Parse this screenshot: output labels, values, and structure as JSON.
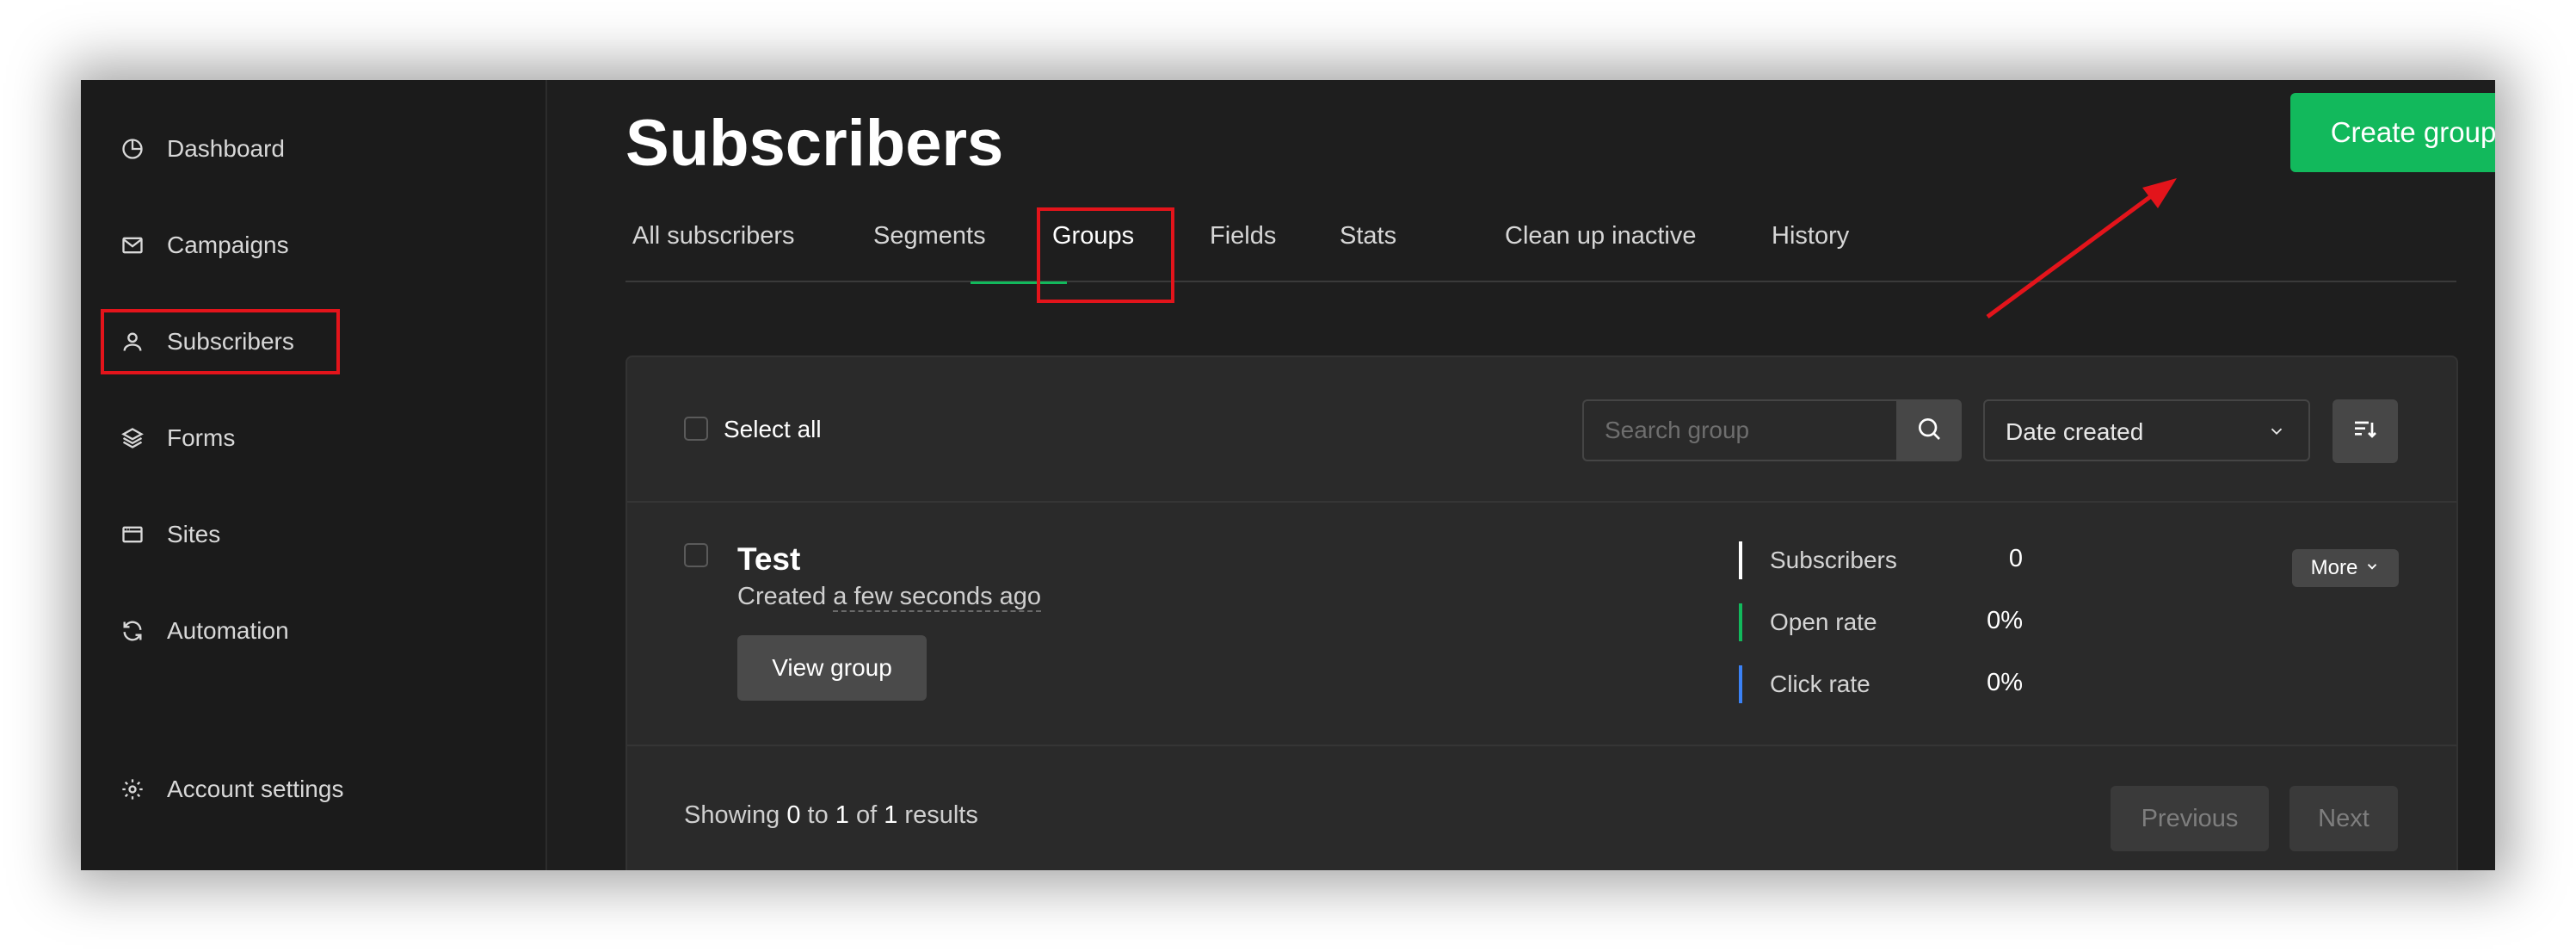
{
  "sidebar": {
    "items": [
      {
        "label": "Dashboard",
        "icon": "dashboard-pie-icon"
      },
      {
        "label": "Campaigns",
        "icon": "envelope-icon"
      },
      {
        "label": "Subscribers",
        "icon": "user-icon",
        "active": true
      },
      {
        "label": "Forms",
        "icon": "layers-icon"
      },
      {
        "label": "Sites",
        "icon": "browser-window-icon"
      },
      {
        "label": "Automation",
        "icon": "refresh-icon"
      }
    ],
    "account_settings": {
      "label": "Account settings",
      "icon": "gear-icon"
    }
  },
  "header": {
    "title": "Subscribers",
    "create_button": "Create group"
  },
  "tabs": [
    {
      "label": "All subscribers"
    },
    {
      "label": "Segments"
    },
    {
      "label": "Groups",
      "active": true
    },
    {
      "label": "Fields"
    },
    {
      "label": "Stats"
    },
    {
      "label": "Clean up inactive"
    },
    {
      "label": "History"
    }
  ],
  "toolbar": {
    "select_all_label": "Select all",
    "search_placeholder": "Search group",
    "search_value": "",
    "sort_value": "Date created"
  },
  "groups": [
    {
      "name": "Test",
      "created_prefix": "Created ",
      "created_relative": "a few seconds ago",
      "view_button": "View group",
      "more_button": "More",
      "stats": [
        {
          "label": "Subscribers",
          "value": "0",
          "color": "#ffffff"
        },
        {
          "label": "Open rate",
          "value": "0%",
          "color": "#12b95c"
        },
        {
          "label": "Click rate",
          "value": "0%",
          "color": "#3b82f6"
        }
      ]
    }
  ],
  "pagination": {
    "showing_prefix": "Showing",
    "from": "0",
    "to_word": "to",
    "to": "1",
    "of_word": "of",
    "total": "1",
    "results_word": "results",
    "previous": "Previous",
    "next": "Next"
  },
  "colors": {
    "accent": "#12b95c",
    "highlight": "#e3141b",
    "background": "#1e1e1e"
  }
}
